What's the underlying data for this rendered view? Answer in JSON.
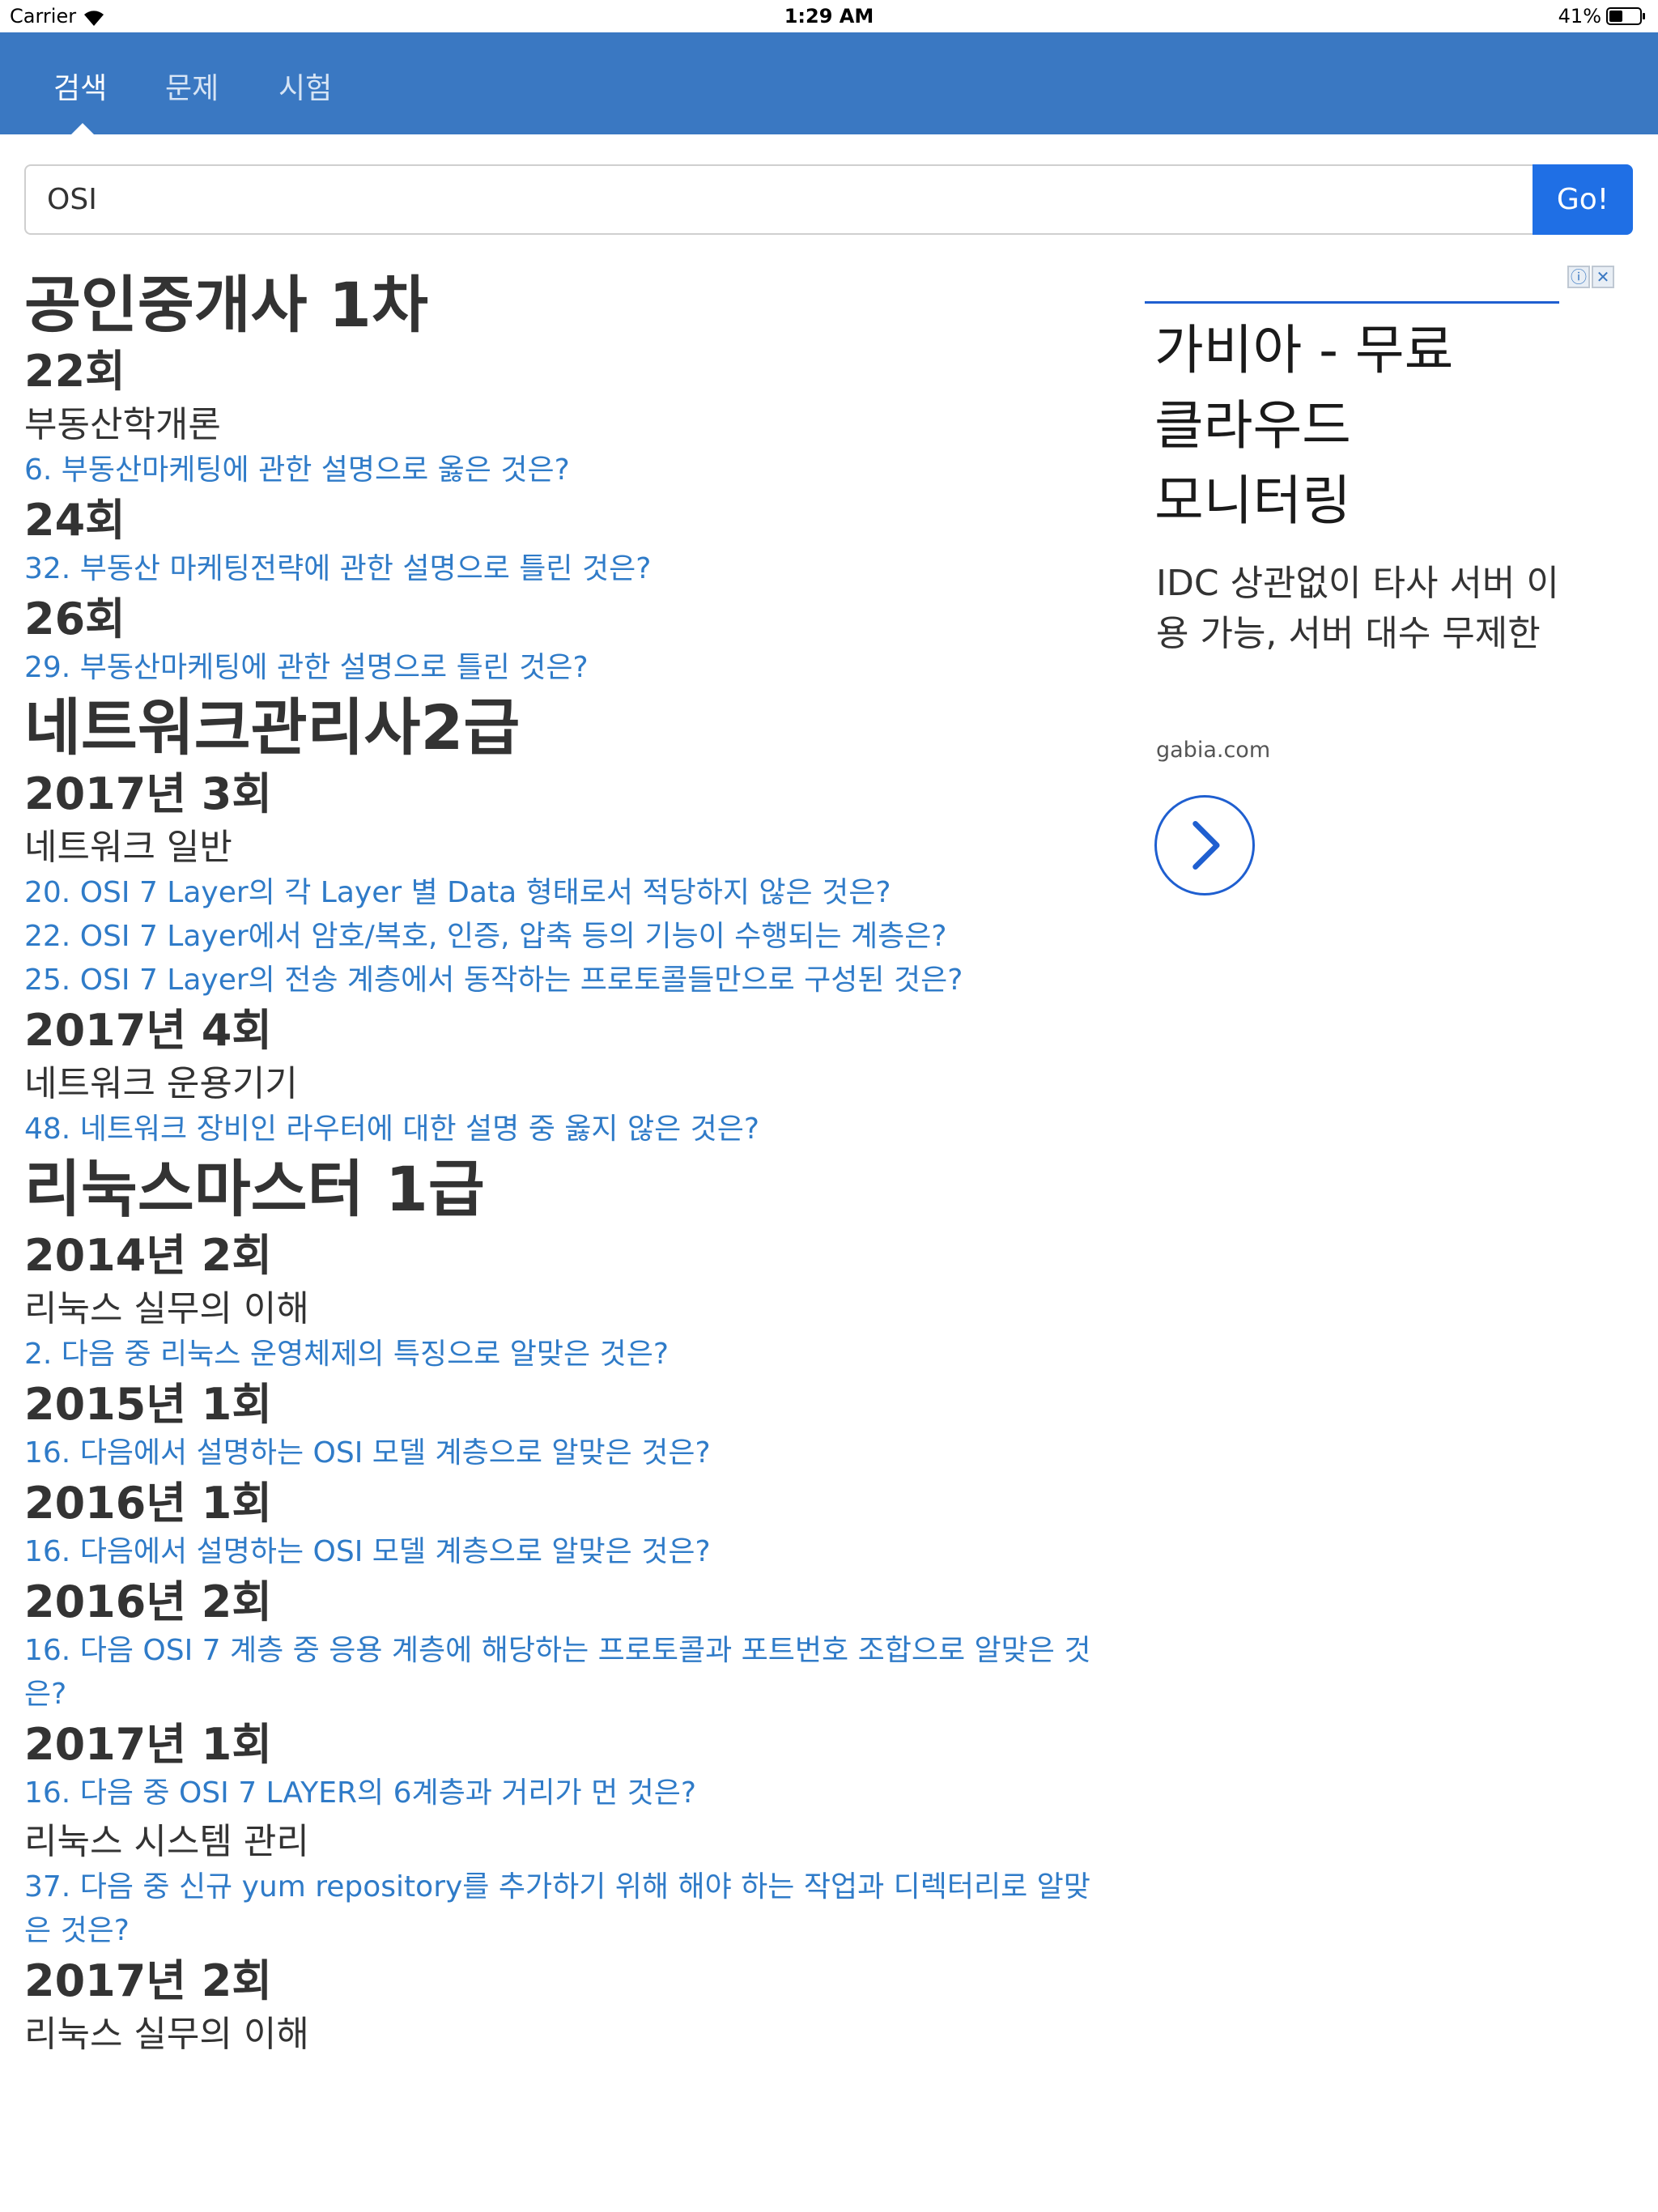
{
  "status_bar": {
    "carrier": "Carrier",
    "time": "1:29 AM",
    "battery": "41%"
  },
  "nav": {
    "tabs": [
      "검색",
      "문제",
      "시험"
    ]
  },
  "search": {
    "value": "OSI",
    "button": "Go!"
  },
  "results": [
    {
      "category": "공인중개사 1차",
      "rounds": [
        {
          "round": "22회",
          "subject": "부동산학개론",
          "questions": [
            "6. 부동산마케팅에 관한 설명으로 옳은 것은?"
          ]
        },
        {
          "round": "24회",
          "subject": "",
          "questions": [
            "32. 부동산 마케팅전략에 관한 설명으로 틀린 것은?"
          ]
        },
        {
          "round": "26회",
          "subject": "",
          "questions": [
            "29. 부동산마케팅에 관한 설명으로 틀린 것은?"
          ]
        }
      ]
    },
    {
      "category": "네트워크관리사2급",
      "rounds": [
        {
          "round": "2017년 3회",
          "subject": "네트워크 일반",
          "questions": [
            "20. OSI 7 Layer의 각 Layer 별 Data 형태로서 적당하지 않은 것은?",
            "22. OSI 7 Layer에서 암호/복호, 인증, 압축 등의 기능이 수행되는 계층은?",
            "25. OSI 7 Layer의 전송 계층에서 동작하는 프로토콜들만으로 구성된 것은?"
          ]
        },
        {
          "round": "2017년 4회",
          "subject": "네트워크 운용기기",
          "questions": [
            "48. 네트워크 장비인 라우터에 대한 설명 중 옳지 않은 것은?"
          ]
        }
      ]
    },
    {
      "category": "리눅스마스터 1급",
      "rounds": [
        {
          "round": "2014년 2회",
          "subject": "리눅스 실무의 이해",
          "questions": [
            "2. 다음 중 리눅스 운영체제의 특징으로 알맞은 것은?"
          ]
        },
        {
          "round": "2015년 1회",
          "subject": "",
          "questions": [
            "16. 다음에서 설명하는 OSI 모델 계층으로 알맞은 것은?"
          ]
        },
        {
          "round": "2016년 1회",
          "subject": "",
          "questions": [
            "16. 다음에서 설명하는 OSI 모델 계층으로 알맞은 것은?"
          ]
        },
        {
          "round": "2016년 2회",
          "subject": "",
          "questions": [
            "16. 다음 OSI 7 계층 중 응용 계층에 해당하는 프로토콜과 포트번호 조합으로 알맞은 것은?"
          ]
        },
        {
          "round": "2017년 1회",
          "subject": "",
          "questions": [
            "16. 다음 중 OSI 7 LAYER의 6계층과 거리가 먼 것은?"
          ]
        },
        {
          "round": "",
          "subject": "리눅스 시스템 관리",
          "questions": [
            "37. 다음 중 신규 yum repository를 추가하기 위해 해야 하는 작업과 디렉터리로 알맞은 것은?"
          ]
        },
        {
          "round": "2017년 2회",
          "subject": "리눅스 실무의 이해",
          "questions": []
        }
      ]
    }
  ],
  "ad": {
    "title_lines": [
      "가비아 - 무료",
      "클라우드",
      "모니터링"
    ],
    "description": "IDC 상관없이 타사 서버 이용 가능, 서버 대수 무제한",
    "domain": "gabia.com",
    "accent": "#1f5fd0"
  }
}
